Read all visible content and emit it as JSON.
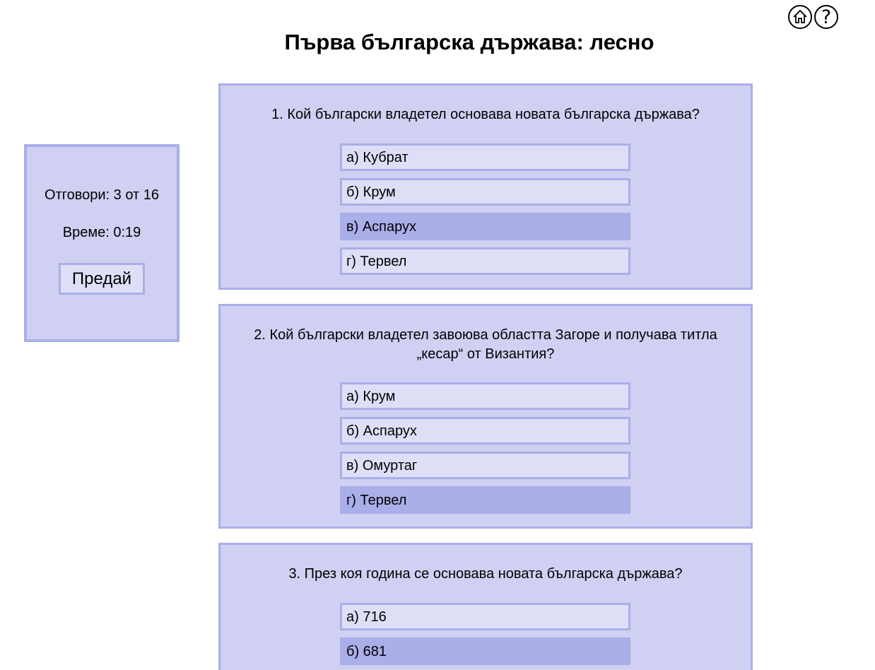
{
  "header": {
    "title": "Първа българска държава: лесно",
    "home_icon": "home-icon",
    "help_icon": "help-icon"
  },
  "status": {
    "answers": "Отговори: 3 от 16",
    "time": "Време: 0:19",
    "submit_label": "Предай"
  },
  "questions": [
    {
      "text": "1. Кой български владетел основава новата българска държава?",
      "options": [
        {
          "label": "а) Кубрат",
          "selected": false
        },
        {
          "label": "б) Крум",
          "selected": false
        },
        {
          "label": "в) Аспарух",
          "selected": true
        },
        {
          "label": "г) Тервел",
          "selected": false
        }
      ]
    },
    {
      "text": "2. Кой български владетел завоюва областта Загоре и получава титла „кесар“ от Византия?",
      "options": [
        {
          "label": "а) Крум",
          "selected": false
        },
        {
          "label": "б) Аспарух",
          "selected": false
        },
        {
          "label": "в) Омуртаг",
          "selected": false
        },
        {
          "label": "г) Тервел",
          "selected": true
        }
      ]
    },
    {
      "text": "3. През коя година се основава новата българска държава?",
      "options": [
        {
          "label": "а) 716",
          "selected": false
        },
        {
          "label": "б) 681",
          "selected": true
        }
      ]
    }
  ]
}
